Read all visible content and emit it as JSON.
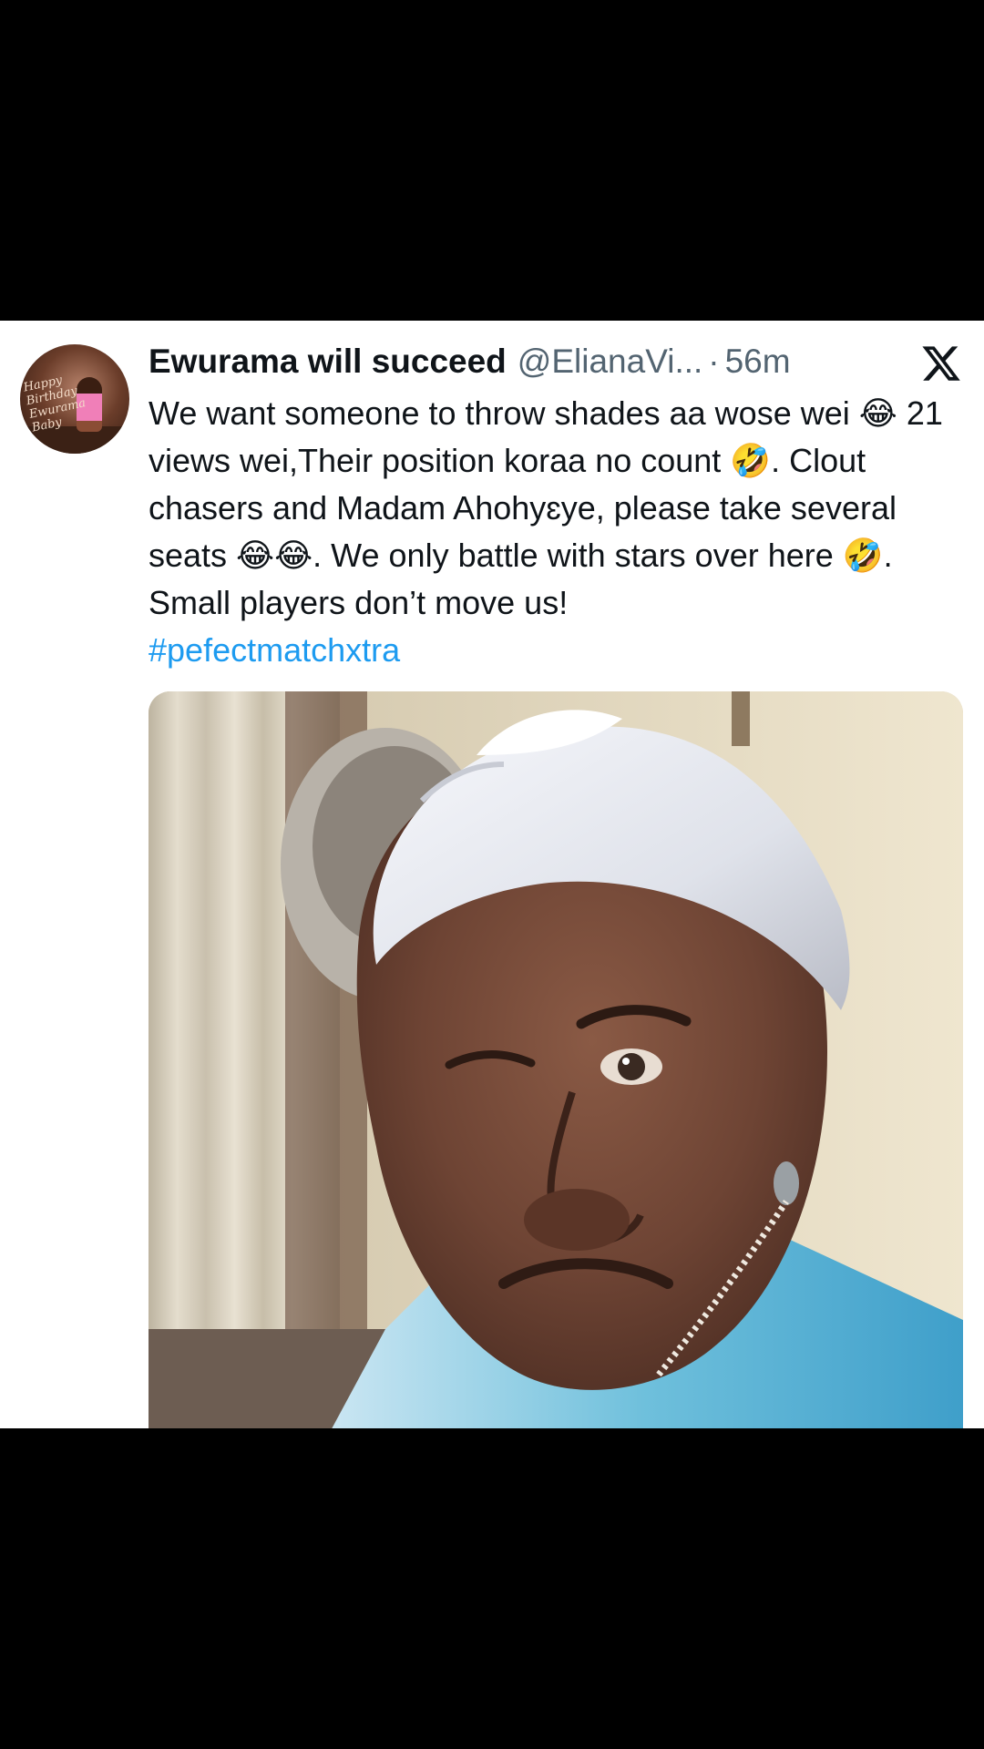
{
  "tweet": {
    "display_name": "Ewurama will succeed",
    "handle": "@ElianaVi...",
    "separator": "·",
    "time": "56m",
    "text_before_hashtag": "We want someone to throw shades aa wose wei 😂 21 views wei,Their position koraa no count 🤣. Clout chasers and Madam Ahohyɛye, please take several seats 😂😂. We only battle with stars over here 🤣. Small players don’t move us!\n",
    "hashtag": "#pefectmatchxtra"
  },
  "avatar": {
    "caption_text": "Happy Birthday Ewurama Baby"
  },
  "icons": {
    "platform_logo": "x-logo-icon"
  },
  "colors": {
    "background": "#000000",
    "card": "#ffffff",
    "text": "#0f1419",
    "muted": "#536471",
    "link": "#1d9bf0"
  }
}
